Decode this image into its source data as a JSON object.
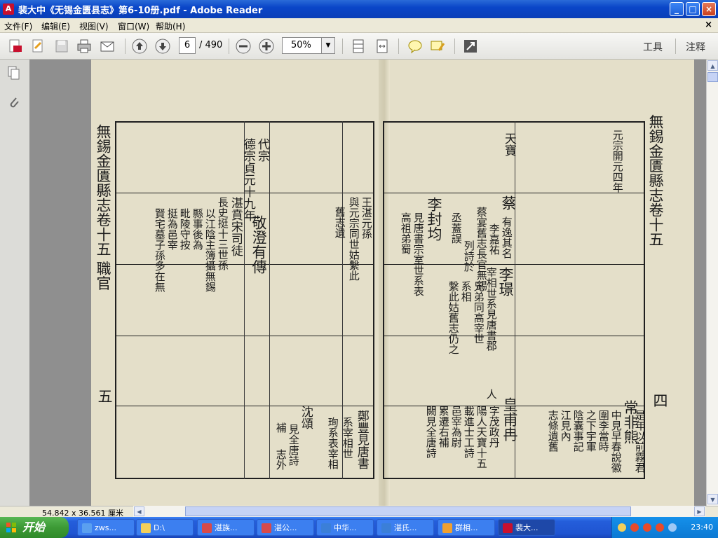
{
  "window": {
    "title": "裴大中《无锡金匮县志》第6-10册.pdf - Adobe Reader",
    "app_icon_letter": "A"
  },
  "window_controls": {
    "minimize": "_",
    "maximize": "□",
    "close": "×"
  },
  "menu": {
    "items": [
      "文件(F)",
      "编辑(E)",
      "视图(V)",
      "窗口(W)",
      "帮助(H)"
    ],
    "close_glyph": "×"
  },
  "toolbar": {
    "page_current": "6",
    "page_total": "/ 490",
    "zoom": "50%",
    "tools_label": "工具",
    "comment_label": "注释",
    "icons": [
      "create-pdf-icon",
      "edit-icon",
      "save-icon",
      "print-icon",
      "email-icon",
      "prev-page-icon",
      "next-page-icon",
      "zoom-out-icon",
      "zoom-in-icon",
      "fit-page-icon",
      "fit-width-icon",
      "comment-icon",
      "highlight-icon",
      "fullscreen-icon"
    ]
  },
  "status": {
    "page_size": "54.842 x 36.561 厘米"
  },
  "document": {
    "left_page": {
      "margin_title": "無錫金匱縣志卷十五 職官",
      "folio": "五",
      "cols": {
        "c1a": "代宗",
        "c1b": "德宗貞元十九年",
        "c2": "敬澄有傳",
        "c3a": "王湛元孫",
        "c3b": "與元宗同世姑繫此",
        "c3c": "舊志遺",
        "c4a": "湛賁宋司徒",
        "c4b": "長史挺十三世孫",
        "c4c": "以江陰主簿攝無錫",
        "c4d": "縣事後為",
        "c4e": "毗陵守按",
        "c4f": "挺為邑宰",
        "c4g": "賢宅墓子孫多在無",
        "c5a": "鄭豐見唐書",
        "c5b": "系宰相世",
        "c5c": "沈頌",
        "c5d": "珣系表宰相",
        "c5e": "見全唐詩",
        "c5f": "補",
        "c5g": "志外"
      }
    },
    "right_page": {
      "margin_title": "無錫金匱縣志卷十五",
      "folio": "四",
      "cols": {
        "r1a": "元宗開元四年",
        "r1b": "天寶",
        "r2a": "蔡",
        "r2b": "有逸其名",
        "r2c": "李嘉祐",
        "r2d": "蔡宴舊志長官無錫",
        "r2e": "列詩於",
        "r2f": "丞蓋誤",
        "r3a": "李璟",
        "r3b": "宰相世系見唐書郡",
        "r3c": "人",
        "r3d": "兄弟同高宰世",
        "r3e": "系相",
        "r3f": "繫此姑舊志仍之",
        "r4a": "李封均",
        "r4b": "見唐書宗室世系表",
        "r4c": "高祖弟蜀",
        "r5a": "常非熊",
        "r5b": "是年以前霧君",
        "r5c": "中見早春說徽",
        "r5d": "圍李當時",
        "r5e": "之下宇軍",
        "r5f": "陰囊事記",
        "r5g": "江見內",
        "r5h": "志條遺舊",
        "r6a": "皇甫冉",
        "r6b": "字茂政丹",
        "r6c": "陽人天寶十五",
        "r6d": "載進士工詩",
        "r6e": "邑宰為尉",
        "r6f": "累遷右補",
        "r6g": "闕見全唐詩"
      }
    }
  },
  "taskbar": {
    "start_label": "开始",
    "tasks": [
      {
        "label": "zws...",
        "color": "#5aa0f0"
      },
      {
        "label": "D:\\",
        "color": "#f2cf5b"
      },
      {
        "label": "湛族...",
        "color": "#d84a4a"
      },
      {
        "label": "湛公...",
        "color": "#d84a4a"
      },
      {
        "label": "中华...",
        "color": "#3b7fd8"
      },
      {
        "label": "湛氏...",
        "color": "#3b7fd8"
      },
      {
        "label": "群相...",
        "color": "#f0a030"
      },
      {
        "label": "裴大...",
        "color": "#c8102e"
      }
    ],
    "clock": "23:40"
  }
}
